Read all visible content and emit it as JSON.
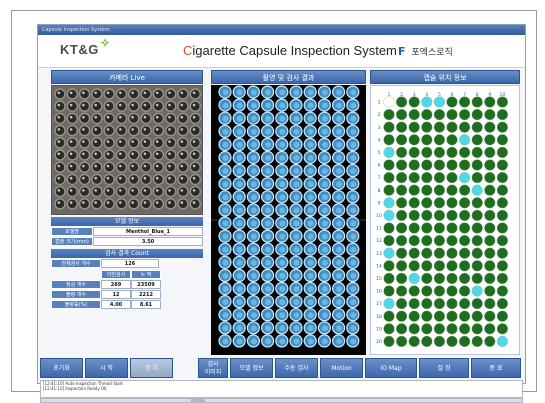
{
  "window": {
    "title": "Capsule Inspection System"
  },
  "header": {
    "brand": "KT&G",
    "app_title": "Cigarette Capsule Inspection System",
    "corp_logo": "F",
    "corp_name": "포엑스로직"
  },
  "panels": {
    "live": "카메라 Live",
    "inspection": "촬영 및 검사 결과",
    "capsule_info": "캡슐 위치 정보"
  },
  "model": {
    "header": "모델 정보",
    "name_label": "모델명",
    "name_value": "Menthol_Blue_1",
    "size_label": "캡슐 크기(mm)",
    "size_value": "3.50"
  },
  "counts": {
    "header": "검사 결과 Count",
    "total_label": "전체검사 개수",
    "total_value": "126",
    "col_current": "이번검사",
    "col_total": "누 적",
    "rows": [
      {
        "label": "정상 개수",
        "current": "289",
        "total": "23509"
      },
      {
        "label": "불량 개수",
        "current": "12",
        "total": "2212"
      },
      {
        "label": "불량률(%)",
        "current": "4.00",
        "total": "8.61"
      }
    ]
  },
  "capsule_grid": {
    "cols": [
      "1",
      "2",
      "3",
      "4",
      "5",
      "6",
      "7",
      "8",
      "9",
      "10"
    ],
    "rows": [
      "1",
      "2",
      "3",
      "4",
      "5",
      "6",
      "7",
      "8",
      "9",
      "10",
      "11",
      "12",
      "13",
      "14",
      "15",
      "16",
      "17",
      "18",
      "19",
      "20"
    ],
    "ok_color": "#1f6e1f",
    "ng_color": "#4fd9e6",
    "empty_color": "#ffffff"
  },
  "buttons": {
    "init": "초기화",
    "start": "시 작",
    "stop": "정 지",
    "inspect_line1": "검사",
    "inspect_line2": "이미지",
    "model_info": "모델 정보",
    "manual": "수동 검사",
    "motion": "Motion",
    "io_map": "IO Map",
    "settings": "설 정",
    "exit": "종 료"
  },
  "log": {
    "lines": [
      "[12:41:10] Auto Inspection Thread Start",
      "[12:41:10] Inspection Ready OK"
    ]
  },
  "page": {}
}
